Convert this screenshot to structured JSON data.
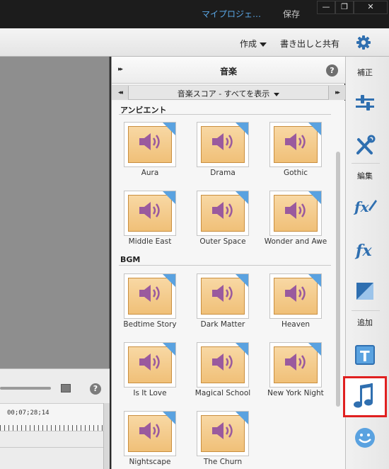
{
  "titlebar": {
    "project_name": "マイプロジェ…",
    "save_label": "保存",
    "min_symbol": "—",
    "max_symbol": "❐",
    "close_symbol": "✕"
  },
  "menubar": {
    "create_label": "作成",
    "export_label": "書き出しと共有"
  },
  "timeline": {
    "timecode": "00;07;28;14",
    "help_symbol": "?"
  },
  "music_panel": {
    "title": "音楽",
    "help_symbol": "?",
    "collapse_symbol": "▸▸",
    "nav_prev_symbol": "◂◂",
    "nav_next_symbol": "▸▸",
    "category_label": "音楽スコア - すべてを表示",
    "sections": [
      {
        "title": "アンビエント",
        "items": [
          {
            "label": "Aura"
          },
          {
            "label": "Drama"
          },
          {
            "label": "Gothic"
          },
          {
            "label": "Middle East"
          },
          {
            "label": "Outer Space"
          },
          {
            "label": "Wonder and Awe"
          }
        ]
      },
      {
        "title": "BGM",
        "items": [
          {
            "label": "Bedtime Story"
          },
          {
            "label": "Dark Matter"
          },
          {
            "label": "Heaven"
          },
          {
            "label": "Is It Love"
          },
          {
            "label": "Magical School"
          },
          {
            "label": "New York Night"
          },
          {
            "label": "Nightscape"
          },
          {
            "label": "The Churn"
          }
        ]
      }
    ],
    "accent_color": "#5aa2e0",
    "thumb_color": "#f0c078",
    "speaker_color": "#9a5a9e"
  },
  "sidebar": {
    "adjust_label": "補正",
    "edit_label": "編集",
    "add_label": "追加",
    "icons": [
      "adjust-sliders-icon",
      "tools-icon",
      "applied-effects-icon",
      "effects-icon",
      "transitions-icon",
      "title-icon",
      "music-icon",
      "graphics-icon"
    ],
    "selected": "music-icon",
    "selected_border_color": "#e02020",
    "icon_color": "#2f6fb0"
  }
}
